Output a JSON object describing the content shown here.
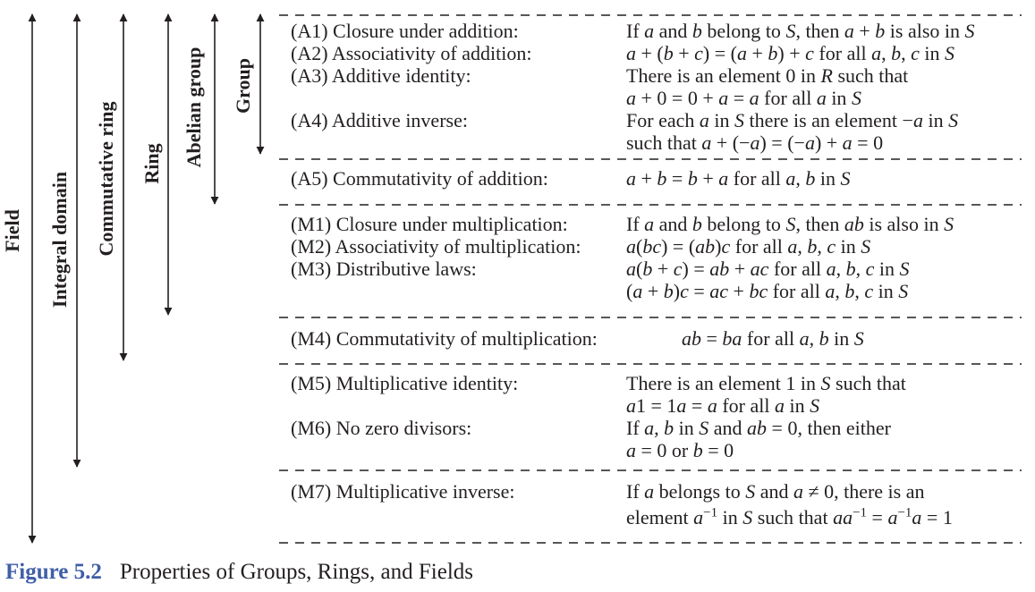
{
  "brackets": [
    {
      "label": "Field",
      "arrow": "double-headed-vertical"
    },
    {
      "label": "Integral domain",
      "arrow": "double-headed-vertical"
    },
    {
      "label": "Commutative ring",
      "arrow": "double-headed-vertical"
    },
    {
      "label": "Ring",
      "arrow": "double-headed-vertical"
    },
    {
      "label": "Abelian group",
      "arrow": "double-headed-vertical"
    },
    {
      "label": "Group",
      "arrow": "double-headed-vertical"
    }
  ],
  "properties": {
    "a1": {
      "name": "(A1) Closure under addition:"
    },
    "a2": {
      "name": "(A2) Associativity of addition:"
    },
    "a3": {
      "name": "(A3) Additive identity:"
    },
    "a4": {
      "name": "(A4) Additive inverse:"
    },
    "a5": {
      "name": "(A5) Commutativity of addition:"
    },
    "m1": {
      "name": "(M1) Closure under multiplication:"
    },
    "m2": {
      "name": "(M2) Associativity of multiplication:"
    },
    "m3": {
      "name": "(M3) Distributive laws:"
    },
    "m4": {
      "name": "(M4) Commutativity of multiplication:"
    },
    "m5": {
      "name": "(M5) Multiplicative identity:"
    },
    "m6": {
      "name": "(M6) No zero divisors:"
    },
    "m7": {
      "name": "(M7) Multiplicative inverse:"
    }
  },
  "definitions": {
    "a1": "If a and b belong to S, then a + b is also in S",
    "a2": "a + (b + c) = (a + b) + c for all a, b, c in S",
    "a3": [
      "There is an element 0 in R such that",
      "a + 0 = 0 + a = a for all a in S"
    ],
    "a4": [
      "For each a in S there is an element −a in S",
      "such that a + (−a) = (−a) + a = 0"
    ],
    "a5": "a + b = b + a for all a, b in S",
    "m1": "If a and b belong to S, then ab is also in S",
    "m2": "a(bc) = (ab)c for all a, b, c in S",
    "m3": [
      "a(b + c) = ab + ac for all a, b, c in S",
      "(a + b)c = ac + bc for all a, b, c in S"
    ],
    "m4": "ab = ba for all a, b in S",
    "m5": [
      "There is an element 1 in S such that",
      "a1 = 1a = a for all a in S"
    ],
    "m6": [
      "If a, b in S and ab = 0, then either",
      "a = 0 or b = 0"
    ],
    "m7": [
      "If a belongs to S and a ≠ 0, there is an",
      "element a⁻¹ in S such that aa⁻¹ = a⁻¹a = 1"
    ]
  },
  "caption": {
    "label": "Figure 5.2",
    "title": "Properties of Groups, Rings, and Fields"
  },
  "colors": {
    "text": "#231f20",
    "caption_label": "#3f5ea8"
  }
}
